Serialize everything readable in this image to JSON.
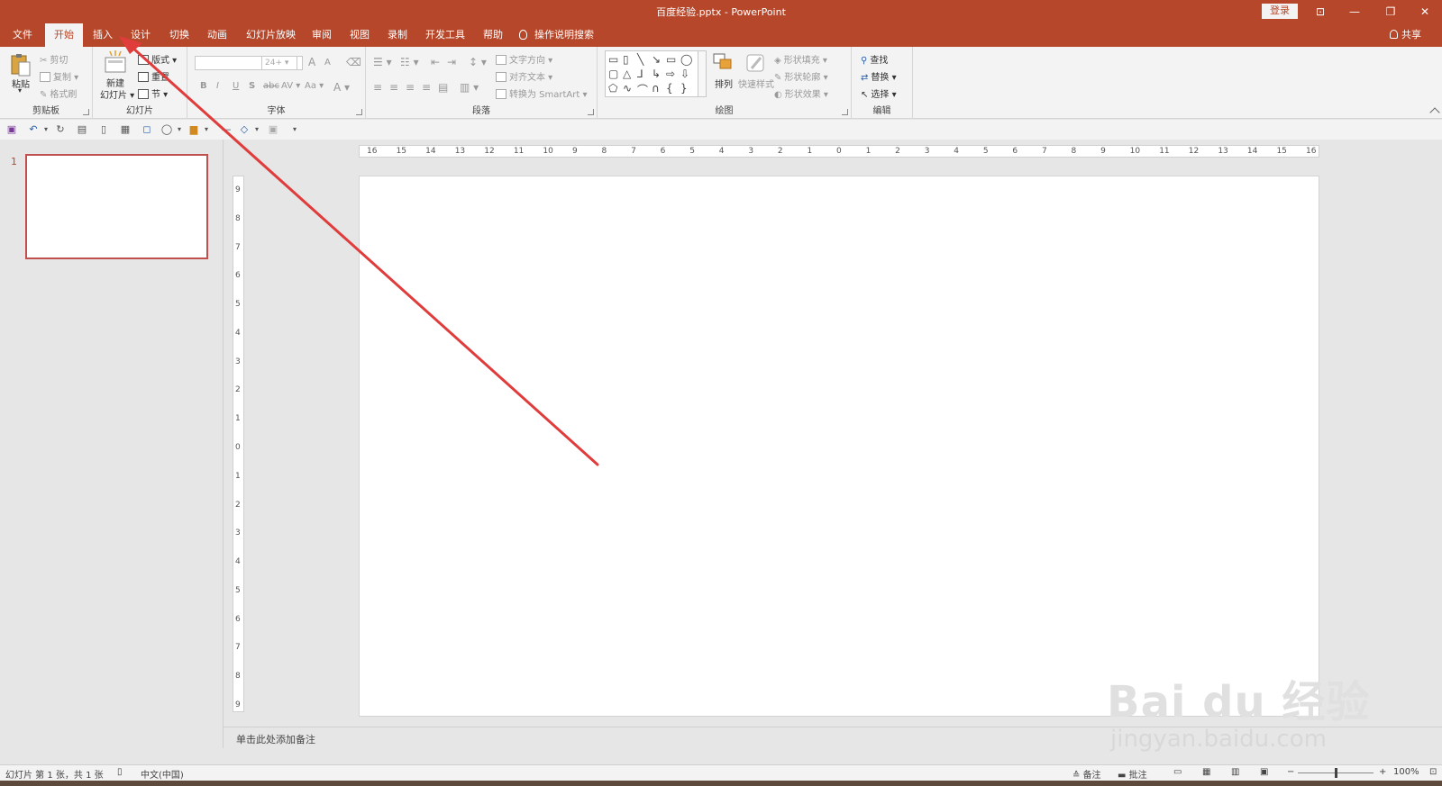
{
  "window": {
    "title": "百度经验.pptx  -  PowerPoint",
    "login_label": "登录",
    "ribbon_display_glyph": "⊡",
    "minimize_glyph": "—",
    "restore_glyph": "❐",
    "close_glyph": "✕"
  },
  "tabs": [
    {
      "label": "文件"
    },
    {
      "label": "开始",
      "active": true
    },
    {
      "label": "插入"
    },
    {
      "label": "设计"
    },
    {
      "label": "切换"
    },
    {
      "label": "动画"
    },
    {
      "label": "幻灯片放映"
    },
    {
      "label": "审阅"
    },
    {
      "label": "视图"
    },
    {
      "label": "录制"
    },
    {
      "label": "开发工具"
    },
    {
      "label": "帮助"
    }
  ],
  "tell_me": "操作说明搜索",
  "share": "共享",
  "ribbon": {
    "clipboard": {
      "label": "剪贴板",
      "paste": "粘贴",
      "cut": "剪切",
      "copy": "复制",
      "format_painter": "格式刷"
    },
    "slides": {
      "label": "幻灯片",
      "new_slide_line1": "新建",
      "new_slide_line2": "幻灯片",
      "layout": "版式",
      "reset": "重置",
      "section": "节"
    },
    "font": {
      "label": "字体",
      "font_size": "24+",
      "bold": "B",
      "italic": "I",
      "underline": "U",
      "shadow": "S",
      "strike": "abc",
      "spacing": "AV",
      "case": "Aa",
      "color": "A",
      "grow": "A",
      "shrink": "A"
    },
    "paragraph": {
      "label": "段落",
      "text_direction": "文字方向",
      "align_text": "对齐文本",
      "smartart": "转换为 SmartArt"
    },
    "drawing": {
      "label": "绘图",
      "arrange": "排列",
      "quick_styles": "快速样式",
      "shape_fill": "形状填充",
      "shape_outline": "形状轮廓",
      "shape_effects": "形状效果"
    },
    "editing": {
      "label": "编辑",
      "find": "查找",
      "replace": "替换",
      "select": "选择"
    }
  },
  "slides": [
    {
      "number": "1"
    }
  ],
  "ruler": {
    "horizontal": [
      "16",
      "15",
      "14",
      "13",
      "12",
      "11",
      "10",
      "9",
      "8",
      "7",
      "6",
      "5",
      "4",
      "3",
      "2",
      "1",
      "0",
      "1",
      "2",
      "3",
      "4",
      "5",
      "6",
      "7",
      "8",
      "9",
      "10",
      "11",
      "12",
      "13",
      "14",
      "15",
      "16"
    ],
    "vertical": [
      "9",
      "8",
      "7",
      "6",
      "5",
      "4",
      "3",
      "2",
      "1",
      "0",
      "1",
      "2",
      "3",
      "4",
      "5",
      "6",
      "7",
      "8",
      "9"
    ]
  },
  "notes_placeholder": "单击此处添加备注",
  "status": {
    "slide_info": "幻灯片 第 1 张，共 1 张",
    "language": "中文(中国)",
    "notes": "备注",
    "comments": "批注",
    "zoom": "100%"
  },
  "watermark": {
    "logo": "Bai du 经验",
    "url": "jingyan.baidu.com"
  },
  "colors": {
    "accent": "#b7472a",
    "annotation_arrow": "#e03c3c"
  }
}
